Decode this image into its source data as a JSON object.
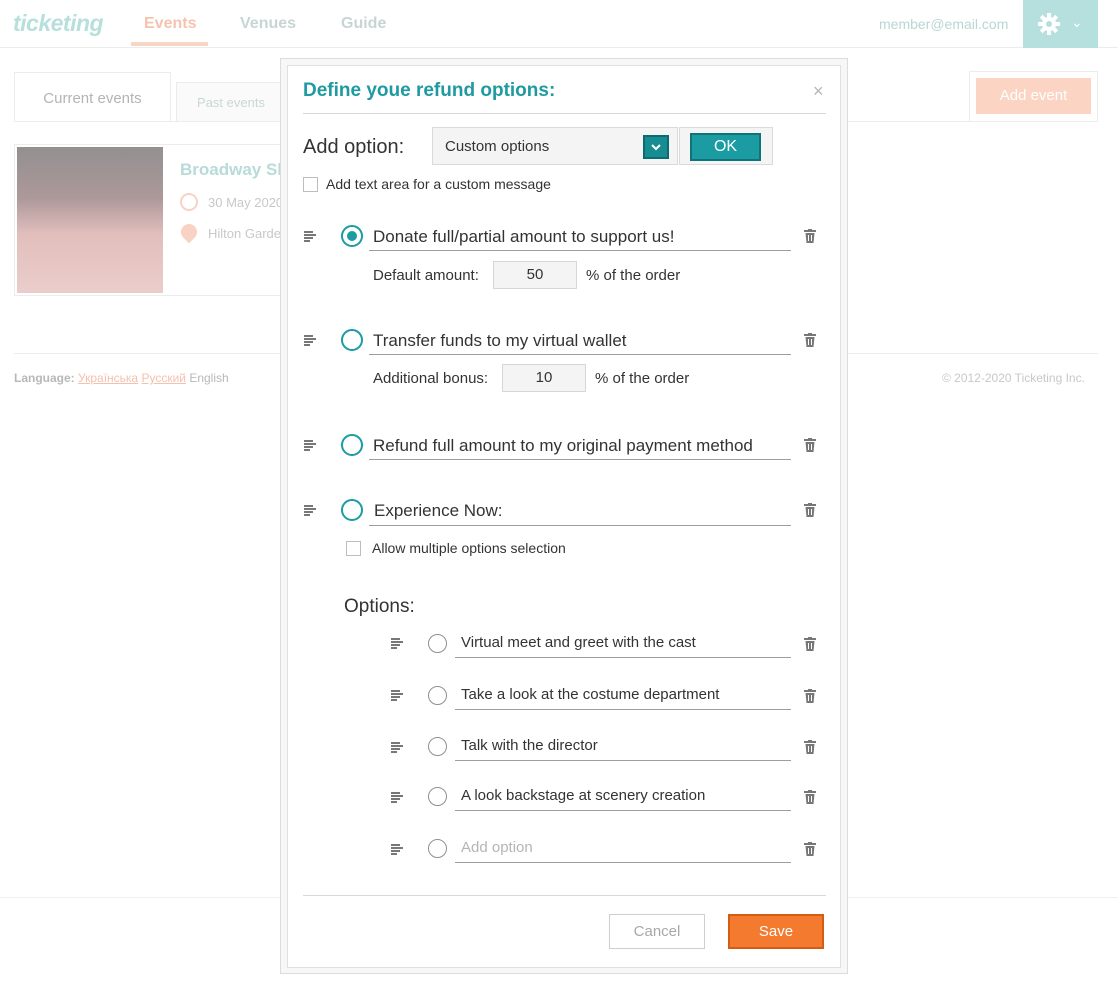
{
  "app": {
    "logo": "ticketing",
    "user_email": "member@email.com"
  },
  "nav": {
    "events": "Events",
    "venues": "Venues",
    "guide": "Guide"
  },
  "tabs": {
    "current": "Current events",
    "past": "Past events"
  },
  "add_event_label": "Add event",
  "event": {
    "title": "Broadway Sh",
    "date": "30 May 2020",
    "place": "Hilton Garde"
  },
  "footer": {
    "language_label": "Language:",
    "languages": [
      "Українська",
      "Русский",
      "English"
    ],
    "copyright": "© 2012-2020 Ticketing Inc."
  },
  "modal": {
    "title": "Define youe refund options:",
    "close": "×",
    "add_option_label": "Add option:",
    "select_value": "Custom options",
    "ok_label": "OK",
    "custom_message_label": "Add text area for a custom message",
    "options": [
      {
        "label": "Donate full/partial amount to support us!",
        "selected": true
      },
      {
        "label": "Transfer funds to my virtual wallet",
        "selected": false
      },
      {
        "label": "Refund full amount to my original payment method",
        "selected": false
      },
      {
        "label": "Experience Now:",
        "selected": false
      }
    ],
    "default_amount": {
      "label": "Default amount:",
      "value": "50",
      "suffix": "% of the order"
    },
    "additional_bonus": {
      "label": "Additional bonus:",
      "value": "10",
      "suffix": "% of the order"
    },
    "allow_multiple_label": "Allow multiple options selection",
    "options_heading": "Options:",
    "sub_options": [
      "Virtual meet and greet with the cast",
      "Take a look at the costume department",
      "Talk with the director",
      "A look backstage at scenery creation"
    ],
    "add_option_placeholder": "Add option",
    "cancel_label": "Cancel",
    "save_label": "Save"
  },
  "colors": {
    "accent": "#1a9ca2",
    "save": "#f37a2f",
    "logo": "#b7e0dd"
  },
  "icons": [
    "gear-icon",
    "chevron-down-icon",
    "close-icon",
    "drag-handle-icon",
    "trash-icon",
    "clock-icon",
    "location-pin-icon"
  ]
}
